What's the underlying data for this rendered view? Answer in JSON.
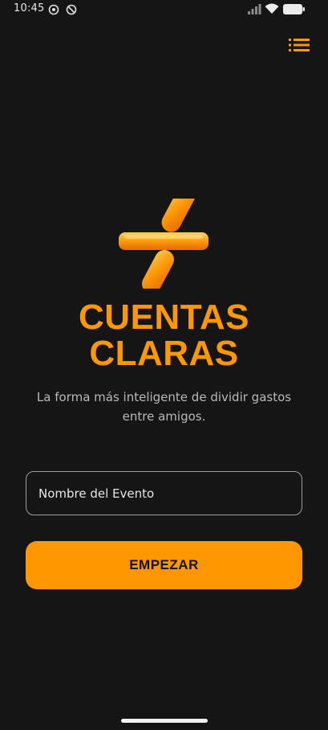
{
  "status_bar": {
    "time": "10:45",
    "icons": [
      "sync-icon",
      "do-not-disturb-icon",
      "signal-icon",
      "wifi-icon",
      "battery-icon"
    ]
  },
  "header": {
    "menu_icon": "list-menu-icon"
  },
  "brand": {
    "logo_icon": "plus-divide-logo-icon",
    "title_line1": "CUENTAS",
    "title_line2": "CLARAS",
    "tagline": "La forma más inteligente de dividir gastos entre amigos."
  },
  "form": {
    "event_name_placeholder": "Nombre del Evento",
    "event_name_value": ""
  },
  "actions": {
    "start_label": "EMPEZAR"
  },
  "colors": {
    "accent": "#FF9800",
    "background": "#151515"
  }
}
